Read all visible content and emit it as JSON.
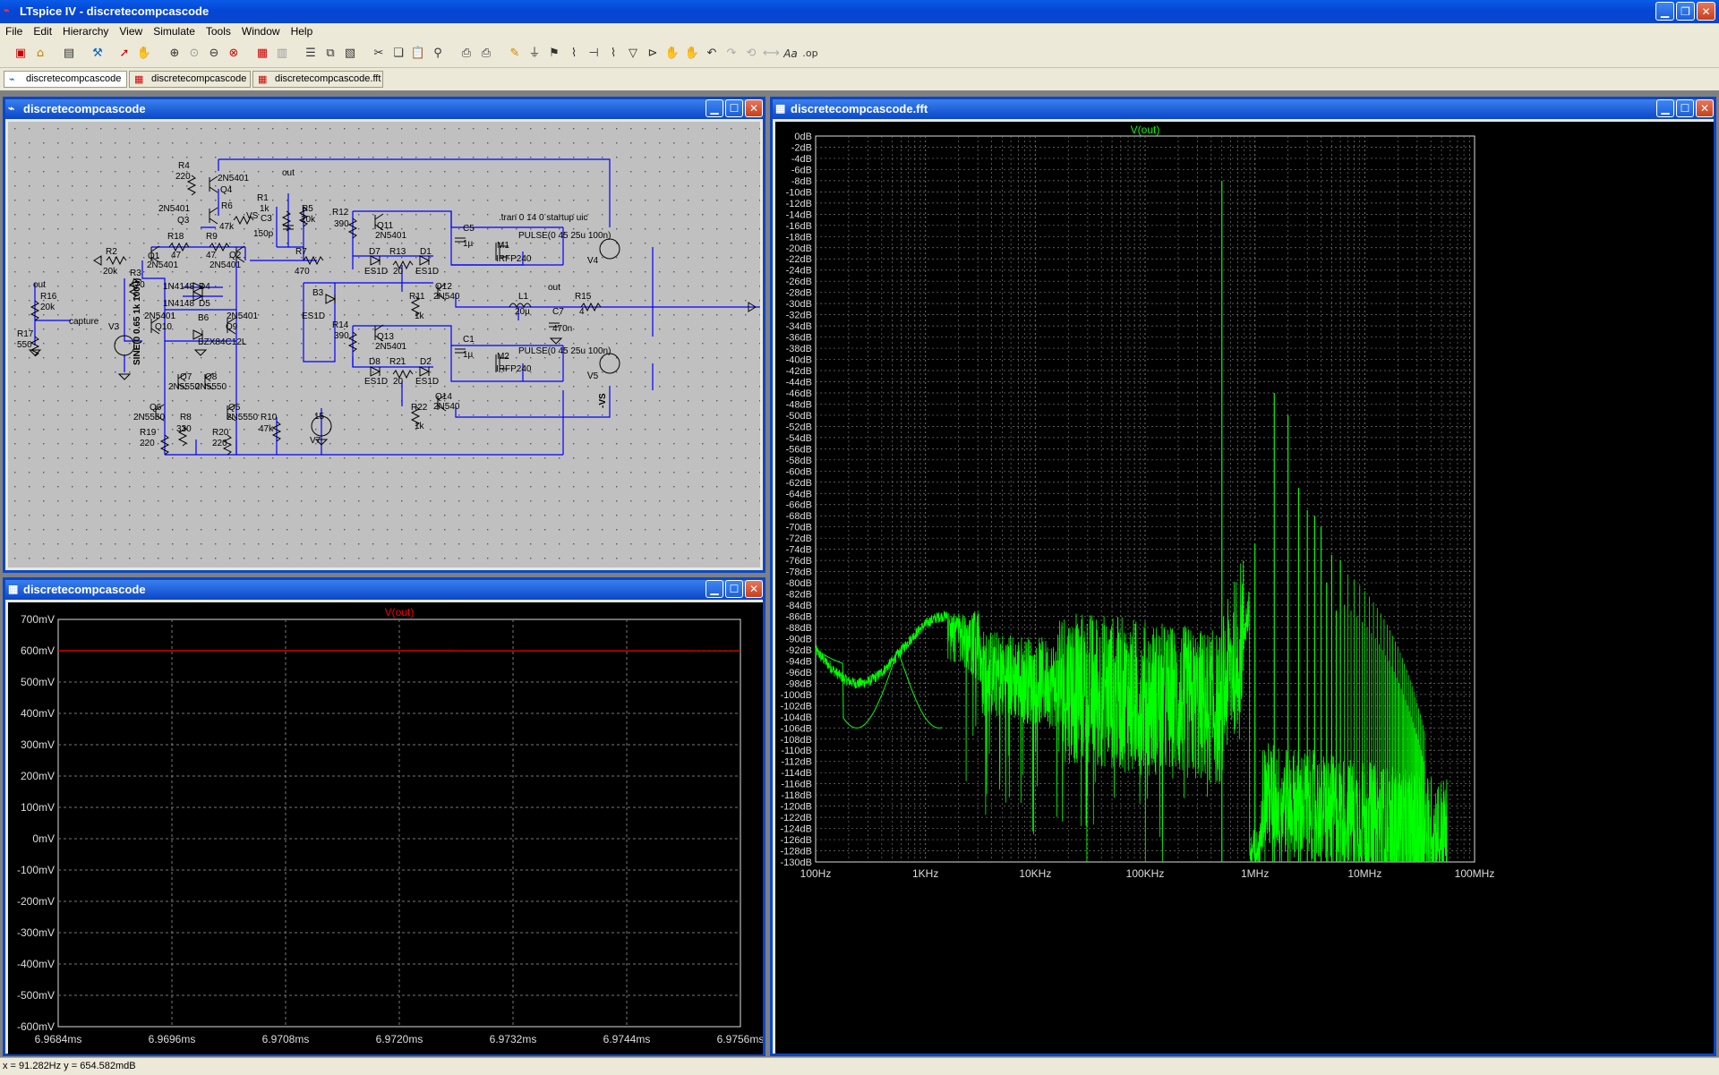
{
  "app": {
    "title": "LTspice IV - discretecompcascode"
  },
  "menu": [
    "File",
    "Edit",
    "Hierarchy",
    "View",
    "Simulate",
    "Tools",
    "Window",
    "Help"
  ],
  "tabs": [
    {
      "label": "discretecompcascode"
    },
    {
      "label": "discretecompcascode"
    },
    {
      "label": "discretecompcascode.fft"
    }
  ],
  "windows": {
    "schematic": {
      "title": "discretecompcascode"
    },
    "waveform": {
      "title": "discretecompcascode"
    },
    "fft": {
      "title": "discretecompcascode.fft"
    }
  },
  "schematic_labels": [
    {
      "t": "R4",
      "x": 190,
      "y": 52
    },
    {
      "t": "220",
      "x": 187,
      "y": 64
    },
    {
      "t": "2N5401",
      "x": 234,
      "y": 66
    },
    {
      "t": "Q4",
      "x": 237,
      "y": 79
    },
    {
      "t": "out",
      "x": 306,
      "y": 60
    },
    {
      "t": "R1",
      "x": 278,
      "y": 88
    },
    {
      "t": "1k",
      "x": 281,
      "y": 100
    },
    {
      "t": "R5",
      "x": 328,
      "y": 100
    },
    {
      "t": "20k",
      "x": 327,
      "y": 112
    },
    {
      "t": "2N5401",
      "x": 168,
      "y": 100
    },
    {
      "t": "Q3",
      "x": 189,
      "y": 113
    },
    {
      "t": "R6",
      "x": 238,
      "y": 97
    },
    {
      "t": "47k",
      "x": 236,
      "y": 120
    },
    {
      "t": "VS",
      "x": 266,
      "y": 108
    },
    {
      "t": "C3",
      "x": 282,
      "y": 111
    },
    {
      "t": "150p",
      "x": 274,
      "y": 128
    },
    {
      "t": "R12",
      "x": 362,
      "y": 104
    },
    {
      "t": "390",
      "x": 364,
      "y": 117
    },
    {
      "t": "Q11",
      "x": 412,
      "y": 119
    },
    {
      "t": "2N5401",
      "x": 410,
      "y": 130
    },
    {
      "t": "C5",
      "x": 508,
      "y": 122
    },
    {
      "t": "1µ",
      "x": 508,
      "y": 139
    },
    {
      ".tran 0 14 0 startup uic": "",
      "t": ".tran 0 14 0 startup uic",
      "x": 548,
      "y": 110
    },
    {
      "t": "M1",
      "x": 546,
      "y": 141
    },
    {
      "t": "PULSE(0 45 25u 100n)",
      "x": 570,
      "y": 130
    },
    {
      "t": "IRFP240",
      "x": 545,
      "y": 156
    },
    {
      "t": "R18",
      "x": 178,
      "y": 131
    },
    {
      "t": "R9",
      "x": 221,
      "y": 131
    },
    {
      "t": "47",
      "x": 182,
      "y": 152
    },
    {
      "t": "47",
      "x": 221,
      "y": 152
    },
    {
      "t": "Q2",
      "x": 247,
      "y": 152
    },
    {
      "t": "2N5401",
      "x": 225,
      "y": 163
    },
    {
      "t": "R2",
      "x": 109,
      "y": 148
    },
    {
      "t": "Q1",
      "x": 156,
      "y": 153
    },
    {
      "t": "2N5401",
      "x": 155,
      "y": 163
    },
    {
      "t": "R3",
      "x": 136,
      "y": 172
    },
    {
      "t": "20k",
      "x": 106,
      "y": 170
    },
    {
      "t": "470",
      "x": 136,
      "y": 185
    },
    {
      "t": "R7",
      "x": 321,
      "y": 148
    },
    {
      "t": "470",
      "x": 320,
      "y": 170
    },
    {
      "t": "D7",
      "x": 403,
      "y": 148
    },
    {
      "t": "R13",
      "x": 426,
      "y": 148
    },
    {
      "t": "D1",
      "x": 460,
      "y": 148
    },
    {
      "t": "ES1D",
      "x": 398,
      "y": 170
    },
    {
      "t": "20",
      "x": 430,
      "y": 170
    },
    {
      "t": "ES1D",
      "x": 455,
      "y": 170
    },
    {
      "t": "V4",
      "x": 647,
      "y": 158
    },
    {
      "t": "Q12",
      "x": 477,
      "y": 187
    },
    {
      "t": "2N540",
      "x": 475,
      "y": 198
    },
    {
      "t": "1N4148",
      "x": 173,
      "y": 187
    },
    {
      "t": "D4",
      "x": 213,
      "y": 187
    },
    {
      "t": "R11",
      "x": 448,
      "y": 198
    },
    {
      "t": "L1",
      "x": 570,
      "y": 198
    },
    {
      "t": "out",
      "x": 603,
      "y": 188
    },
    {
      "t": "R15",
      "x": 633,
      "y": 198
    },
    {
      "t": "R16",
      "x": 36,
      "y": 198
    },
    {
      "t": "out",
      "x": 28,
      "y": 185
    },
    {
      "t": "20k",
      "x": 36,
      "y": 210
    },
    {
      "t": "B3",
      "x": 340,
      "y": 194
    },
    {
      "t": "1N4148",
      "x": 173,
      "y": 206
    },
    {
      "t": "D5",
      "x": 213,
      "y": 206
    },
    {
      "t": "20µ",
      "x": 566,
      "y": 215
    },
    {
      "t": "C7",
      "x": 608,
      "y": 215
    },
    {
      "t": "4",
      "x": 638,
      "y": 215
    },
    {
      "t": "2N5401",
      "x": 152,
      "y": 220
    },
    {
      "t": "B6",
      "x": 212,
      "y": 222
    },
    {
      "t": "2N5401",
      "x": 244,
      "y": 220
    },
    {
      "t": "ES1D",
      "x": 328,
      "y": 220
    },
    {
      "t": "1k",
      "x": 454,
      "y": 220
    },
    {
      "t": "capture",
      "x": 68,
      "y": 226
    },
    {
      "t": "V3",
      "x": 112,
      "y": 232
    },
    {
      "t": "Q10",
      "x": 164,
      "y": 232
    },
    {
      "t": "Q9",
      "x": 243,
      "y": 232
    },
    {
      "t": "470n",
      "x": 608,
      "y": 234
    },
    {
      "t": "R14",
      "x": 362,
      "y": 230
    },
    {
      "t": "Q13",
      "x": 412,
      "y": 243
    },
    {
      "t": "390",
      "x": 364,
      "y": 242
    },
    {
      "t": "2N5401",
      "x": 410,
      "y": 254
    },
    {
      "t": "C1",
      "x": 508,
      "y": 246
    },
    {
      "t": "R17",
      "x": 10,
      "y": 240
    },
    {
      "t": "550",
      "x": 10,
      "y": 252
    },
    {
      "t": "BZX84C12L",
      "x": 212,
      "y": 249
    },
    {
      "t": "PULSE(0 45 25u 100n)",
      "x": 570,
      "y": 259
    },
    {
      "t": "1µ",
      "x": 508,
      "y": 263
    },
    {
      "t": "M2",
      "x": 546,
      "y": 265
    },
    {
      "t": "D8",
      "x": 403,
      "y": 271
    },
    {
      "t": "R21",
      "x": 426,
      "y": 271
    },
    {
      "t": "D2",
      "x": 460,
      "y": 271
    },
    {
      "t": "IRFP240",
      "x": 545,
      "y": 279
    },
    {
      "t": "Q7",
      "x": 192,
      "y": 288
    },
    {
      "t": "Q8",
      "x": 220,
      "y": 288
    },
    {
      "t": "V5",
      "x": 647,
      "y": 287
    },
    {
      "t": "2N5550",
      "x": 179,
      "y": 299
    },
    {
      "t": "2N5550",
      "x": 209,
      "y": 299
    },
    {
      "t": "ES1D",
      "x": 398,
      "y": 293
    },
    {
      "t": "20",
      "x": 430,
      "y": 293
    },
    {
      "t": "ES1D",
      "x": 455,
      "y": 293
    },
    {
      "t": "Q14",
      "x": 477,
      "y": 310
    },
    {
      "t": "R22",
      "x": 450,
      "y": 322
    },
    {
      "t": "2N540",
      "x": 475,
      "y": 321
    },
    {
      "t": "Q6",
      "x": 158,
      "y": 322
    },
    {
      "t": "Q5",
      "x": 246,
      "y": 322
    },
    {
      "t": "R8",
      "x": 192,
      "y": 333
    },
    {
      "t": "15",
      "x": 342,
      "y": 332
    },
    {
      "t": "2N5550",
      "x": 140,
      "y": 333
    },
    {
      "t": "2N5550",
      "x": 244,
      "y": 333
    },
    {
      "t": "R10",
      "x": 282,
      "y": 333
    },
    {
      "t": "1k",
      "x": 454,
      "y": 343
    },
    {
      "t": "330",
      "x": 188,
      "y": 346
    },
    {
      "t": "47k",
      "x": 280,
      "y": 346
    },
    {
      "t": "R19",
      "x": 147,
      "y": 350
    },
    {
      "t": "R20",
      "x": 228,
      "y": 350
    },
    {
      "t": "220",
      "x": 147,
      "y": 362
    },
    {
      "t": "220",
      "x": 228,
      "y": 362
    },
    {
      "t": "V7",
      "x": 337,
      "y": 359
    }
  ],
  "schematic_vlabels": [
    {
      "t": "SINE(0 0.65 1k 100u)",
      "x": 147,
      "y": 272
    },
    {
      "t": "-VS",
      "x": 667,
      "y": 320
    }
  ],
  "waveform_plot": {
    "chart_data": {
      "type": "line",
      "series": [
        {
          "name": "V(out)",
          "color": "#ff0000",
          "amplitude_mv": 600,
          "frequency_hz": 1000
        }
      ],
      "title": "V(out)",
      "x_ticks": [
        "6.9684ms",
        "6.9696ms",
        "6.9708ms",
        "6.9720ms",
        "6.9732ms",
        "6.9744ms",
        "6.9756ms"
      ],
      "y_ticks": [
        "700mV",
        "600mV",
        "500mV",
        "400mV",
        "300mV",
        "200mV",
        "100mV",
        "0mV",
        "-100mV",
        "-200mV",
        "-300mV",
        "-400mV",
        "-500mV",
        "-600mV"
      ],
      "xlim_ms": [
        6.9684,
        6.9756
      ],
      "ylim_mv": [
        -600,
        700
      ],
      "grid": true
    }
  },
  "fft_plot": {
    "chart_data": {
      "type": "line",
      "series": [
        {
          "name": "V(out)",
          "color": "#00ff00"
        }
      ],
      "title": "V(out)",
      "x_ticks": [
        "100Hz",
        "1KHz",
        "10KHz",
        "100KHz",
        "1MHz",
        "10MHz",
        "100MHz"
      ],
      "y_ticks": [
        "0dB",
        "-2dB",
        "-4dB",
        "-6dB",
        "-8dB",
        "-10dB",
        "-12dB",
        "-14dB",
        "-16dB",
        "-18dB",
        "-20dB",
        "-22dB",
        "-24dB",
        "-26dB",
        "-28dB",
        "-30dB",
        "-32dB",
        "-34dB",
        "-36dB",
        "-38dB",
        "-40dB",
        "-42dB",
        "-44dB",
        "-46dB",
        "-48dB",
        "-50dB",
        "-52dB",
        "-54dB",
        "-56dB",
        "-58dB",
        "-60dB",
        "-62dB",
        "-64dB",
        "-66dB",
        "-68dB",
        "-70dB",
        "-72dB",
        "-74dB",
        "-76dB",
        "-78dB",
        "-80dB",
        "-82dB",
        "-84dB",
        "-86dB",
        "-88dB",
        "-90dB",
        "-92dB",
        "-94dB",
        "-96dB",
        "-98dB",
        "-100dB",
        "-102dB",
        "-104dB",
        "-106dB",
        "-108dB",
        "-110dB",
        "-112dB",
        "-114dB",
        "-116dB",
        "-118dB",
        "-120dB",
        "-122dB",
        "-124dB",
        "-126dB",
        "-128dB",
        "-130dB"
      ],
      "xlim_hz": [
        100,
        100000000
      ],
      "ylim_db": [
        -130,
        0
      ],
      "x_scale": "log",
      "grid": true,
      "harmonics": [
        {
          "f_hz": 500000,
          "db": -8
        },
        {
          "f_hz": 1000000,
          "db": -73
        },
        {
          "f_hz": 1500000,
          "db": -46
        },
        {
          "f_hz": 2000000,
          "db": -50
        },
        {
          "f_hz": 2500000,
          "db": -63
        },
        {
          "f_hz": 3000000,
          "db": -67
        },
        {
          "f_hz": 3500000,
          "db": -68
        },
        {
          "f_hz": 4000000,
          "db": -70
        },
        {
          "f_hz": 4500000,
          "db": -80
        },
        {
          "f_hz": 5000000,
          "db": -75
        },
        {
          "f_hz": 5500000,
          "db": -85
        },
        {
          "f_hz": 6000000,
          "db": -76
        }
      ]
    }
  },
  "status": {
    "text": "x = 91.282Hz   y = 654.582mdB"
  }
}
